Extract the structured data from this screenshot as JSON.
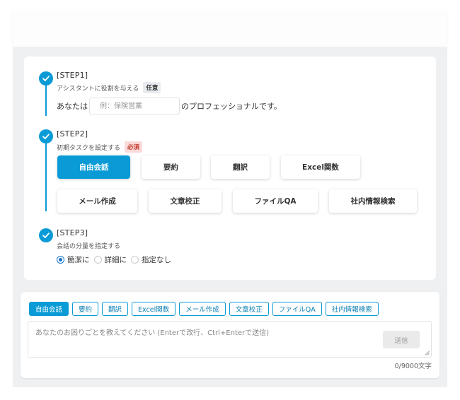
{
  "step1": {
    "title": "[STEP1]",
    "subtitle": "アシスタントに役割を与える",
    "badge": "任意",
    "prefix": "あなたは",
    "placeholder": "例：保険営業",
    "suffix": "のプロフェッショナルです。"
  },
  "step2": {
    "title": "[STEP2]",
    "subtitle": "初期タスクを設定する",
    "badge": "必須",
    "tasks": [
      "自由会話",
      "要約",
      "翻訳",
      "Excel関数",
      "メール作成",
      "文章校正",
      "ファイルQA",
      "社内情報検索"
    ],
    "selected": "自由会話"
  },
  "step3": {
    "title": "[STEP3]",
    "subtitle": "会話の分量を指定する",
    "options": [
      "簡潔に",
      "詳細に",
      "指定なし"
    ],
    "selected": "簡潔に"
  },
  "chat": {
    "chips": [
      "自由会話",
      "要約",
      "翻訳",
      "Excel関数",
      "メール作成",
      "文章校正",
      "ファイルQA",
      "社内情報検索"
    ],
    "selected_chip": "自由会話",
    "placeholder": "あなたのお困りごとを教えてください (Enterで改行、Ctrl+Enterで送信)",
    "value": "",
    "send_label": "送信",
    "counter": "0/9000文字"
  },
  "colors": {
    "accent": "#0a9bd6",
    "required": "#c0392b"
  }
}
